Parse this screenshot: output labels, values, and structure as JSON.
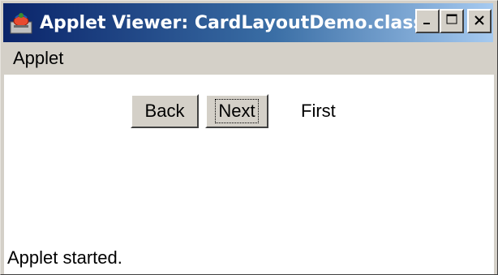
{
  "window": {
    "title": "Applet Viewer: CardLayoutDemo.class",
    "controls": {
      "minimize": "_",
      "maximize": "□",
      "close": "✕"
    }
  },
  "menu": {
    "items": [
      "Applet"
    ]
  },
  "applet": {
    "back_label": "Back",
    "next_label": "Next",
    "card_label": "First"
  },
  "status": {
    "text": "Applet started."
  },
  "icons": {
    "app": "java-applet-icon"
  }
}
